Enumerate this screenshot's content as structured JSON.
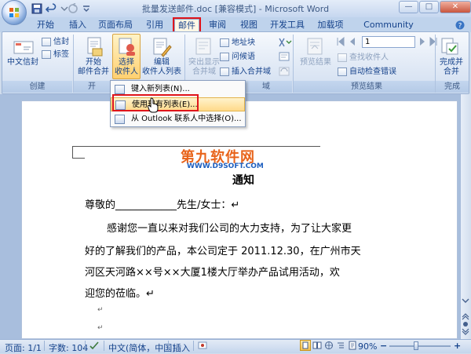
{
  "window": {
    "title": "批量发送邮件.doc [兼容模式] - Microsoft Word",
    "buttons": {
      "minimize": "—",
      "maximize": "□",
      "close": "✕"
    }
  },
  "tabs": [
    {
      "label": "开始"
    },
    {
      "label": "插入"
    },
    {
      "label": "页面布局"
    },
    {
      "label": "引用"
    },
    {
      "label": "邮件",
      "active": true
    },
    {
      "label": "审阅"
    },
    {
      "label": "视图"
    },
    {
      "label": "开发工具"
    },
    {
      "label": "加载项"
    },
    {
      "label": "Community Clips"
    }
  ],
  "ribbon": {
    "create": {
      "label": "创建",
      "envelope_label": "中文信封",
      "envelopes": "信封",
      "labels": "标签"
    },
    "start_merge": {
      "label": "开",
      "start_line1": "开始",
      "start_line2": "邮件合并",
      "select_line1": "选择",
      "select_line2": "收件人",
      "edit_line1": "编辑",
      "edit_line2": "收件人列表"
    },
    "write_insert": {
      "label": "域",
      "highlight_line1": "突出显示",
      "highlight_line2": "合并域",
      "address_block": "地址块",
      "greeting_line": "问候语",
      "insert_field": "插入合并域"
    },
    "preview": {
      "label": "预览结果",
      "preview_btn": "预览结果",
      "record_number": "1",
      "find_recipient": "查找收件人",
      "auto_check": "自动检查错误"
    },
    "finish": {
      "label": "完成",
      "finish_line1": "完成并",
      "finish_line2": "合并"
    }
  },
  "menu": {
    "items": [
      {
        "label": "键入新列表(N)..."
      },
      {
        "label": "使用现有列表(E)...",
        "highlighted": true
      },
      {
        "label": "从 Outlook 联系人中选择(O)..."
      }
    ]
  },
  "watermark": {
    "logo_text": "第九软件网",
    "url": "WWW.D9SOFT.COM"
  },
  "document": {
    "heading": "通知",
    "lines": [
      "尊敬的____________先生/女士：↵",
      "感谢您一直以来对我们公司的大力支持，为了让大家更",
      "好的了解我们的产品，本公司定于 2011.12.30，在广州市天",
      "河区天河路××号××大厦1楼大厅举办产品试用活动，欢",
      "迎您的莅临。↵",
      "↵",
      "↵"
    ]
  },
  "status": {
    "page": "页面: 1/1",
    "words": "字数: 104",
    "language": "中文(简体，中国)",
    "mode": "插入",
    "zoom": "90%",
    "zoom_out": "−",
    "zoom_in": "+"
  },
  "colors": {
    "ribbon_text": "#15428b",
    "highlight_box": "#e0151b",
    "menu_highlight": "#ffd98a"
  }
}
